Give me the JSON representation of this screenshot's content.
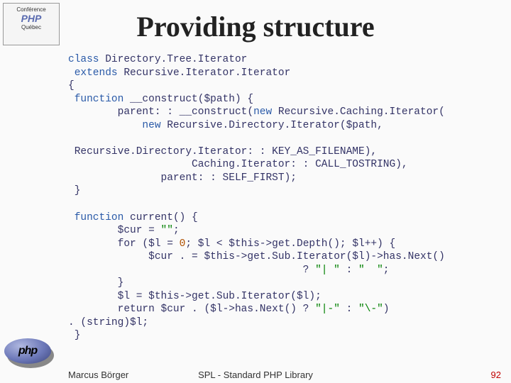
{
  "logos": {
    "top_text": "Conférence",
    "top_sub": "Québec",
    "bottom_text": "php"
  },
  "title": "Providing structure",
  "code": {
    "l01a": "class ",
    "l01b": "Directory.Tree.Iterator",
    "l02a": " extends ",
    "l02b": "Recursive.Iterator.Iterator",
    "l03": "{",
    "l04a": " function ",
    "l04b": "__construct",
    "l04c": "(",
    "l04d": "$path",
    "l04e": ") {",
    "l05a": "        parent",
    "l05b": ": : ",
    "l05c": "__construct",
    "l05d": "(",
    "l05e": "new ",
    "l05f": "Recursive.Caching.Iterator",
    "l05g": "(",
    "l06a": "            new ",
    "l06b": "Recursive.Directory.Iterator",
    "l06c": "(",
    "l06d": "$path",
    "l06e": ",",
    "blank1": "",
    "l07a": " Recursive.Directory.Iterator",
    "l07b": ": : ",
    "l07c": "KEY_AS_FILENAME",
    "l07d": "),",
    "l08a": "                    Caching.Iterator",
    "l08b": ": : ",
    "l08c": "CALL_TOSTRING",
    "l08d": "),",
    "l09a": "               parent",
    "l09b": ": : ",
    "l09c": "SELF_FIRST",
    "l09d": ");",
    "l10": " }",
    "blank2": "",
    "l11a": " function ",
    "l11b": "current",
    "l11c": "() {",
    "l12a": "        ",
    "l12b": "$cur ",
    "l12c": "= ",
    "l12d": "\"\"",
    "l12e": ";",
    "l13a": "        for (",
    "l13b": "$l ",
    "l13c": "= ",
    "l13d": "0",
    "l13e": "; ",
    "l13f": "$l ",
    "l13g": "< ",
    "l13h": "$this",
    "l13i": "->get.Depth(); ",
    "l13j": "$l",
    "l13k": "++) {",
    "l14a": "             ",
    "l14b": "$cur ",
    "l14c": ". = ",
    "l14d": "$this",
    "l14e": "->get.Sub.Iterator(",
    "l14f": "$l",
    "l14g": ")->has.Next()",
    "l15a": "                                      ? ",
    "l15b": "\"| \" ",
    "l15c": ": ",
    "l15d": "\"  \"",
    "l15e": ";",
    "l16": "        }",
    "l17a": "        ",
    "l17b": "$l ",
    "l17c": "= ",
    "l17d": "$this",
    "l17e": "->get.Sub.Iterator(",
    "l17f": "$l",
    "l17g": ");",
    "l18a": "        return ",
    "l18b": "$cur ",
    "l18c": ". (",
    "l18d": "$l",
    "l18e": "->has.Next() ? ",
    "l18f": "\"|-\" ",
    "l18g": ": ",
    "l18h": "\"\\-\"",
    "l18i": ")",
    "l19a": ". (string)",
    "l19b": "$l",
    "l19c": ";",
    "l20": " }"
  },
  "footer": {
    "author": "Marcus Börger",
    "center": "SPL - Standard PHP Library",
    "page": "92"
  }
}
